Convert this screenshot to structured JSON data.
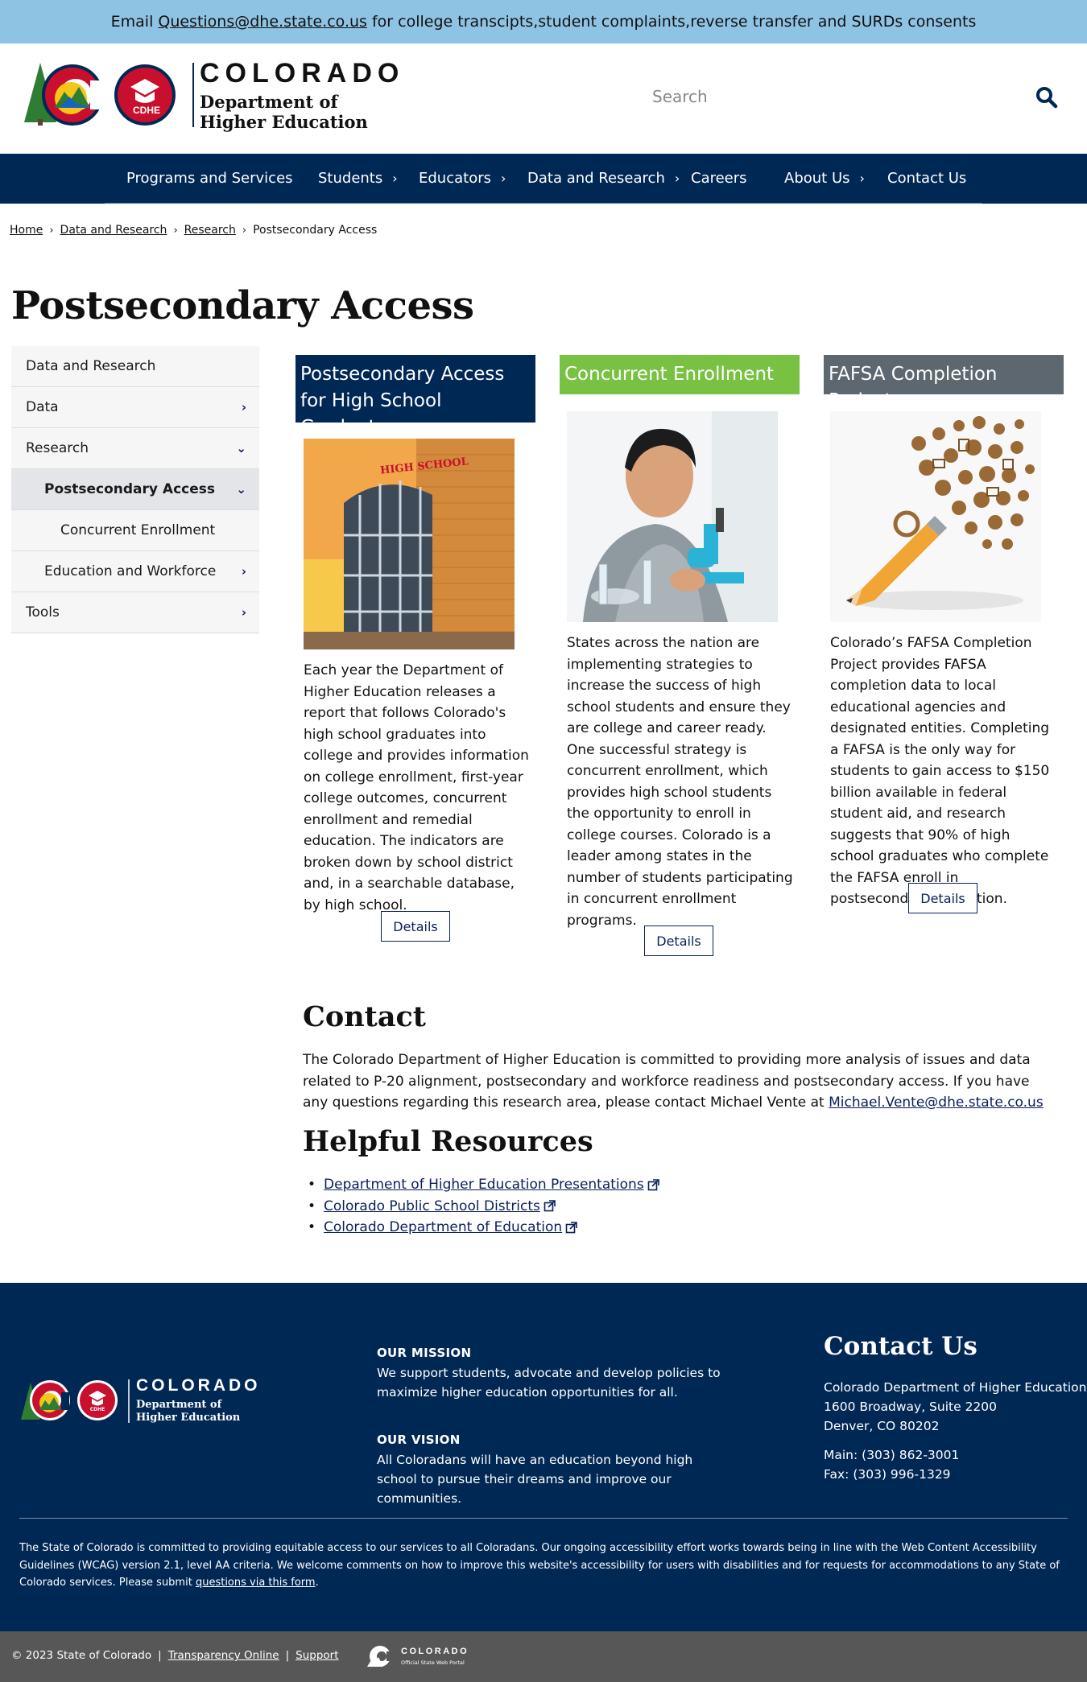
{
  "alert": {
    "prefix": "Email",
    "email": "Questions@dhe.state.co.us",
    "suffix": "for college transcipts,student complaints,reverse transfer and SURDs consents"
  },
  "header": {
    "logo_wordmark": "COLORADO",
    "logo_line1": "Department of",
    "logo_line2": "Higher Education",
    "logo_badge": "CDHE",
    "search_placeholder": "Search"
  },
  "nav": {
    "items": [
      {
        "label": "Programs and Services",
        "has_menu": false
      },
      {
        "label": "Students",
        "has_menu": true
      },
      {
        "label": "Educators",
        "has_menu": true
      },
      {
        "label": "Data and Research",
        "has_menu": true
      },
      {
        "label": "Careers",
        "has_menu": false
      },
      {
        "label": "About Us",
        "has_menu": true
      },
      {
        "label": "Contact Us",
        "has_menu": false
      }
    ],
    "chevron": "›"
  },
  "breadcrumb": {
    "items": [
      "Home",
      "Data and Research",
      "Research",
      "Postsecondary Access"
    ],
    "sep": "›"
  },
  "page_title": "Postsecondary Access",
  "sidenav": {
    "items": [
      {
        "label": "Data and Research",
        "icon": ""
      },
      {
        "label": "Data",
        "icon": "›"
      },
      {
        "label": "Research",
        "icon": "⌄"
      },
      {
        "label": "Postsecondary Access",
        "icon": "⌄"
      },
      {
        "label": "Concurrent Enrollment",
        "icon": ""
      },
      {
        "label": "Education and Workforce",
        "icon": "›"
      },
      {
        "label": "Tools",
        "icon": "›"
      }
    ]
  },
  "cards": [
    {
      "title": "Postsecondary Access for High School Graduates",
      "color": "#002855",
      "image_sign": "HIGH SCHOOL",
      "text": "Each year the Department of Higher Education releases a report that follows Colorado's high school graduates into college and provides information on college enrollment, first-year college outcomes, concurrent enrollment and remedial education. The indicators are broken down by school district and, in a searchable database, by high school.",
      "button": "Details"
    },
    {
      "title": "Concurrent Enrollment",
      "color": "#78c142",
      "text": "States across the nation are implementing strategies to increase the success of high school students and ensure they are college and career ready. One successful strategy is concurrent enrollment, which provides high school students the opportunity to enroll in college courses. Colorado is a leader among states in the number of students participating in concurrent enrollment programs.",
      "button": "Details"
    },
    {
      "title": "FAFSA Completion Project",
      "color": "#5d6770",
      "text": "Colorado’s FAFSA Completion Project provides FAFSA completion data to local educational agencies and designated entities. Completing a FAFSA is the only way for students to gain access to $150 billion available in federal student aid, and research suggests that 90% of high school graduates who complete the FAFSA enroll in postsecondary education.",
      "button": "Details"
    }
  ],
  "contact": {
    "heading": "Contact",
    "text": "The Colorado Department of Higher Education is committed to providing more analysis of issues and data related to P-20 alignment, postsecondary and workforce readiness and postsecondary access. If you have any questions regarding this research area, please contact Michael Vente at",
    "email": "Michael.Vente@dhe.state.co.us"
  },
  "resources": {
    "heading": "Helpful Resources",
    "links": [
      "Department of Higher Education Presentations",
      "Colorado Public School Districts",
      "Colorado Department of Education"
    ]
  },
  "footer": {
    "mission_label": "OUR MISSION",
    "mission_text": "We support students, advocate and develop policies to maximize higher education opportunities for all.",
    "vision_label": "OUR VISION",
    "vision_text": "All Coloradans will have an education beyond high school to pursue their dreams and improve our communities.",
    "contact_heading": "Contact Us",
    "org": "Colorado Department of Higher Education",
    "address1": "1600 Broadway, Suite 2200",
    "address2": "Denver, CO 80202",
    "main": "Main: (303) 862-3001",
    "fax": "Fax: (303) 996-1329",
    "accessibility_text": "The State of Colorado is committed to providing equitable access to our services to all Coloradans. Our ongoing accessibility effort works towards being in line with the Web Content Accessibility Guidelines (WCAG) version 2.1, level AA criteria. We welcome comments on how to improve this website's accessibility for users with disabilities and for requests for accommodations to any State of Colorado services. Please submit",
    "accessibility_link": "questions via this form",
    "accessibility_end": "."
  },
  "bottom_bar": {
    "copyright": "© 2023 State of Colorado",
    "sep": "|",
    "link1": "Transparency Online",
    "link2": "Support",
    "portal_wordmark": "COLORADO",
    "portal_sub": "Official State Web Portal"
  }
}
